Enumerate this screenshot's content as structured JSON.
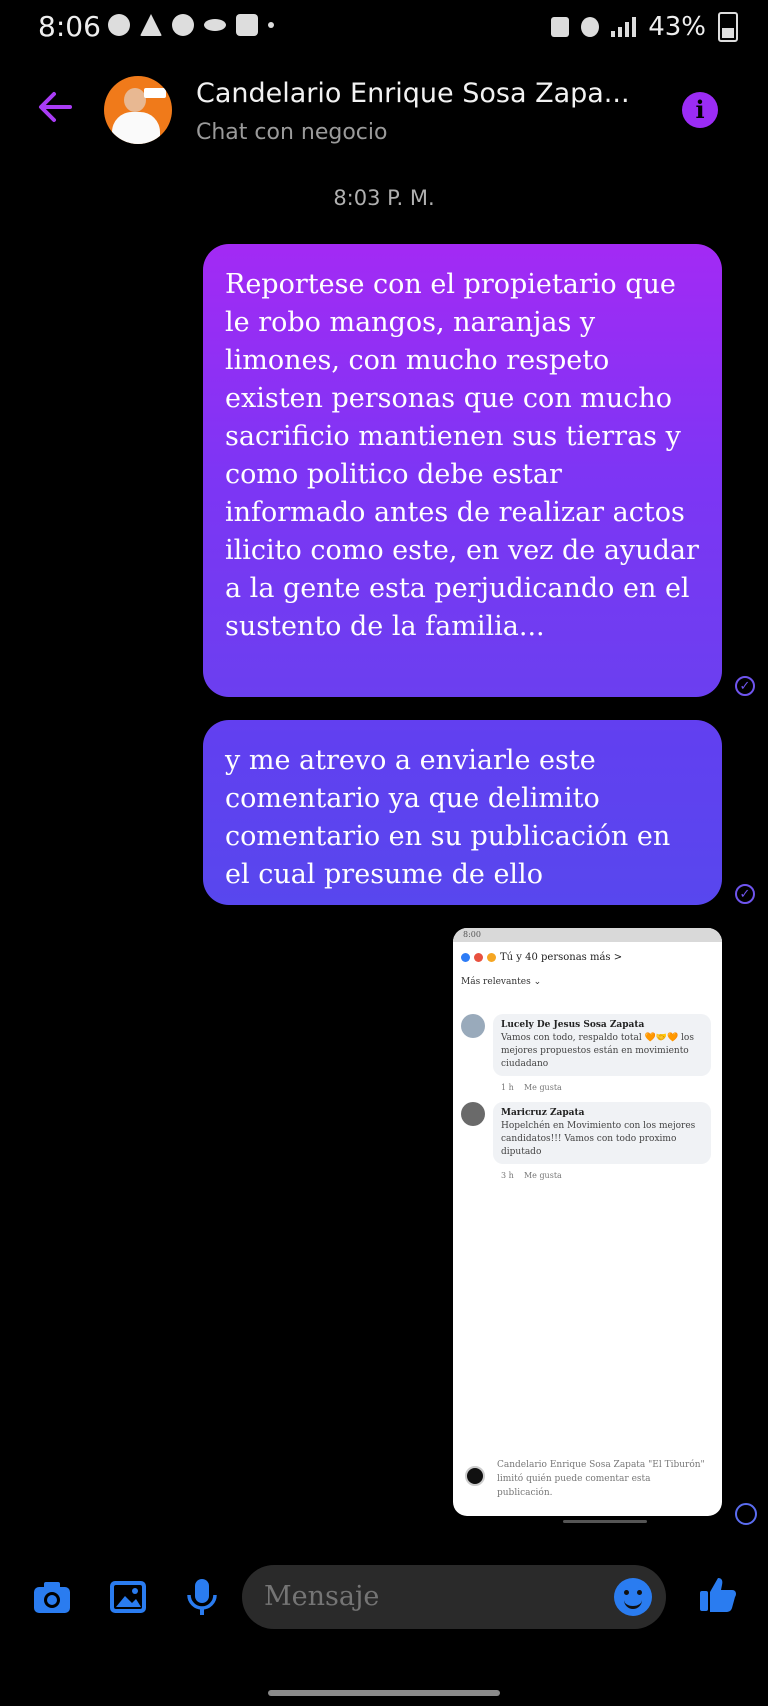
{
  "status_bar": {
    "time": "8:06",
    "battery": "43%"
  },
  "header": {
    "contact_name": "Candelario Enrique Sosa Zapa...",
    "subtitle": "Chat con negocio",
    "accent_color": "#9b2cf5"
  },
  "thread": {
    "timestamp": "8:03 P. M.",
    "messages": [
      {
        "text": "Reportese  con el propietario que le robo mangos, naranjas y limones, con mucho respeto existen personas que con mucho sacrificio mantienen sus tierras y como politico debe estar informado antes de realizar actos ilicito como este, en vez de ayudar a la gente esta perjudicando en el sustento de la familia..."
      },
      {
        "text": "y me atrevo  a enviarle este comentario ya que delimito comentario en su publicación en el cual presume de ello"
      }
    ]
  },
  "attachment": {
    "status_time": "8:00",
    "reactions": "Tú y 40 personas más >",
    "sort_label": "Más relevantes ⌄",
    "comments": [
      {
        "author": "Lucely De Jesus Sosa Zapata",
        "text": "Vamos con todo, respaldo total 🧡🤝🧡 los mejores propuestos están en movimiento ciudadano",
        "time": "1 h",
        "like": "Me gusta"
      },
      {
        "author": "Maricruz Zapata",
        "text": "Hopelchén en Movimiento con los mejores candidatos!!! Vamos con todo proximo diputado",
        "time": "3 h",
        "like": "Me gusta"
      }
    ],
    "footer": "Candelario Enrique Sosa Zapata \"El Tiburón\" limitó quién puede comentar esta publicación."
  },
  "composer": {
    "placeholder": "Mensaje",
    "icons": [
      "camera-icon",
      "gallery-icon",
      "microphone-icon",
      "emoji-icon",
      "like-icon"
    ]
  }
}
